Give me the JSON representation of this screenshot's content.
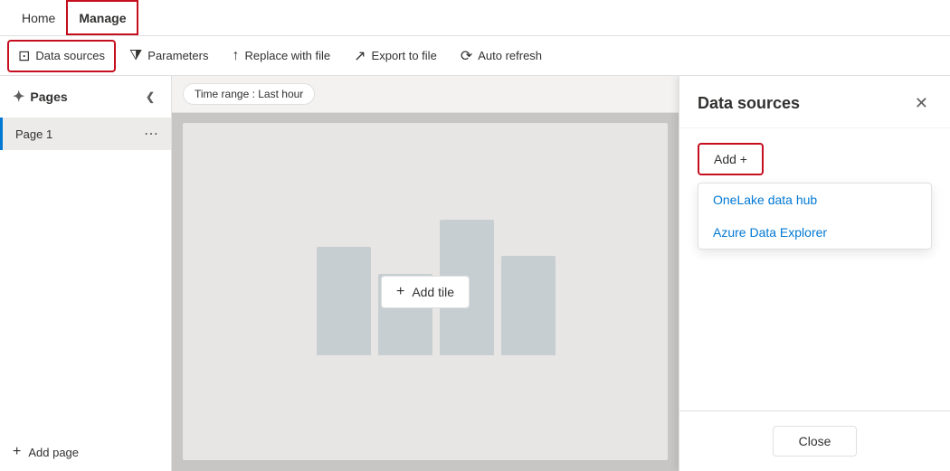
{
  "nav": {
    "items": [
      {
        "id": "home",
        "label": "Home",
        "active": false
      },
      {
        "id": "manage",
        "label": "Manage",
        "active": true
      }
    ]
  },
  "toolbar": {
    "items": [
      {
        "id": "data-sources",
        "label": "Data sources",
        "icon": "datasource",
        "active": true
      },
      {
        "id": "parameters",
        "label": "Parameters",
        "icon": "filter",
        "active": false
      },
      {
        "id": "replace-with-file",
        "label": "Replace with file",
        "icon": "replace",
        "active": false
      },
      {
        "id": "export-to-file",
        "label": "Export to file",
        "icon": "export",
        "active": false
      },
      {
        "id": "auto-refresh",
        "label": "Auto refresh",
        "icon": "refresh",
        "active": false
      }
    ]
  },
  "time_range": {
    "label": "Time range : Last hour"
  },
  "sidebar": {
    "title": "Pages",
    "pages": [
      {
        "id": "page1",
        "label": "Page 1"
      }
    ],
    "add_page_label": "Add page"
  },
  "canvas": {
    "add_tile_label": "Add tile"
  },
  "right_panel": {
    "title": "Data sources",
    "add_label": "Add +",
    "menu_items": [
      {
        "id": "onelake",
        "label": "OneLake data hub"
      },
      {
        "id": "adx",
        "label": "Azure Data Explorer"
      }
    ],
    "close_label": "Close"
  }
}
